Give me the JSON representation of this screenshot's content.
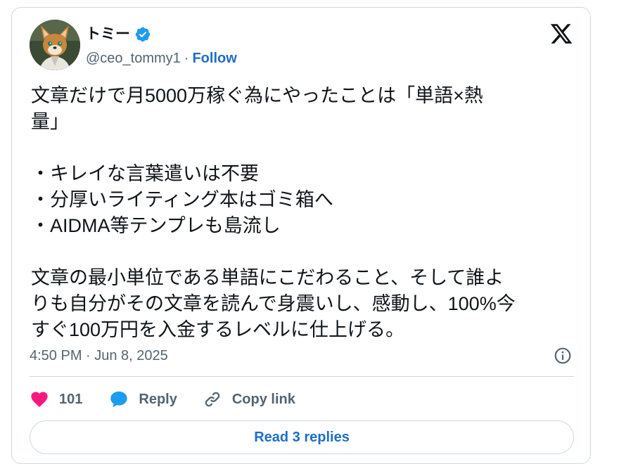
{
  "user": {
    "display_name": "トミー",
    "handle": "@ceo_tommy1",
    "separator": "·",
    "follow_label": "Follow"
  },
  "tweet": {
    "text": "文章だけで月5000万稼ぐ為にやったことは「単語×熱\n量」\n\n・キレイな言葉遣いは不要\n・分厚いライティング本はゴミ箱へ\n・AIDMA等テンプレも島流し\n\n文章の最小単位である単語にこだわること、そして誰よ\nりも自分がその文章を読んで身震いし、感動し、100%今\nすぐ100万円を入金するレベルに仕上げる。",
    "timestamp": "4:50 PM · Jun 8, 2025"
  },
  "actions": {
    "like_count": "101",
    "reply_label": "Reply",
    "copy_link_label": "Copy link"
  },
  "read_replies_label": "Read 3 replies",
  "colors": {
    "accent": "#1d6ec7",
    "like": "#f91880",
    "reply_icon": "#1d9bf0",
    "verified": "#1d9bf0",
    "muted": "#536471",
    "border": "#cfd9de"
  },
  "icons": {
    "brand": "x-logo-icon",
    "verified": "verified-badge-icon",
    "info": "info-icon",
    "like": "heart-icon",
    "reply": "speech-bubble-icon",
    "copy": "link-icon"
  }
}
